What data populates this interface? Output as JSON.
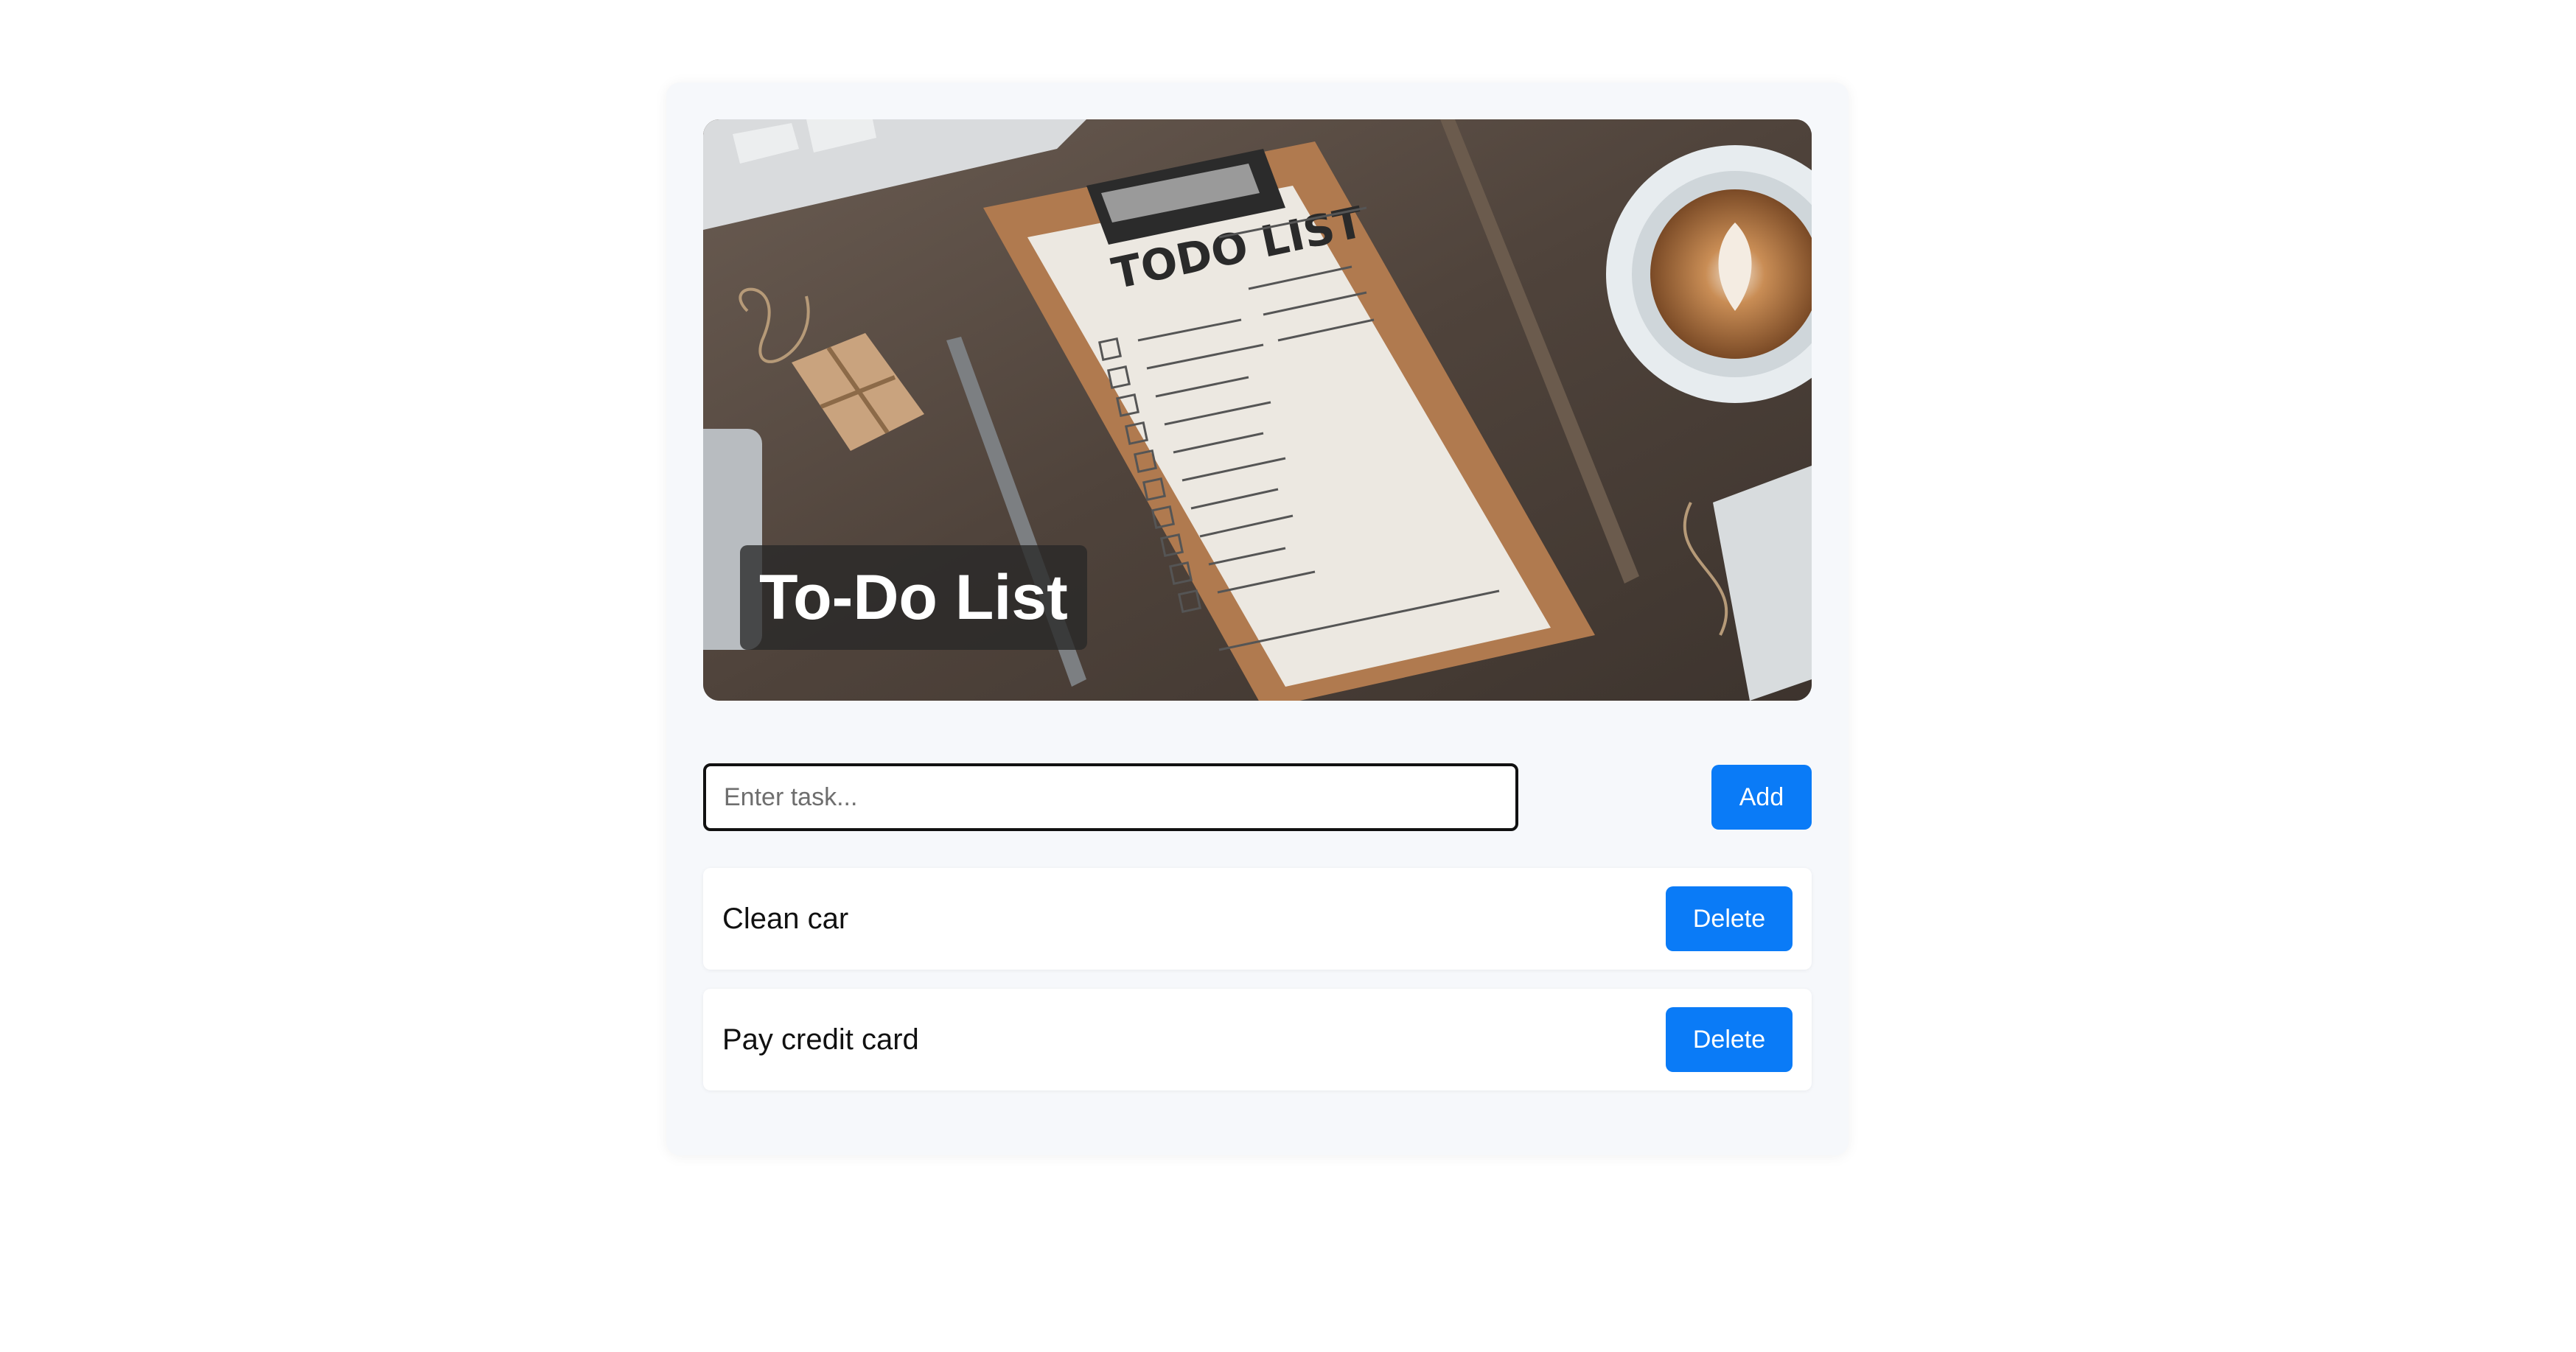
{
  "app": {
    "title": "To-Do List"
  },
  "hero": {
    "icon": "todo-list-photo",
    "clipboard_heading": "TODO LIST"
  },
  "input": {
    "placeholder": "Enter task...",
    "value": ""
  },
  "buttons": {
    "add_label": "Add",
    "delete_label": "Delete"
  },
  "tasks": [
    {
      "text": "Clean car"
    },
    {
      "text": "Pay credit card"
    }
  ],
  "colors": {
    "accent": "#0a7bf7",
    "card_bg": "#f6f8fb",
    "page_bg": "#ffffff"
  }
}
